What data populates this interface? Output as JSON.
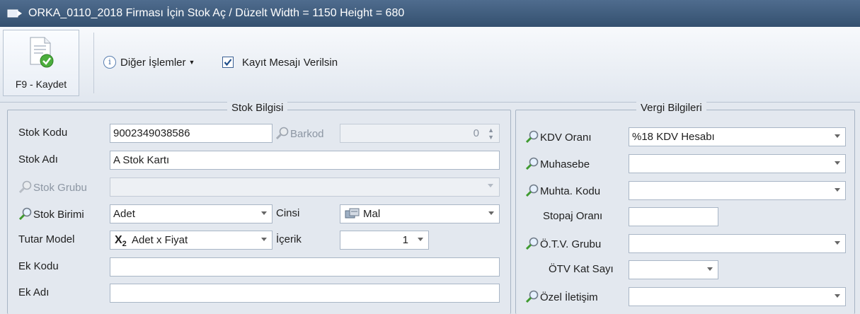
{
  "window": {
    "title": "ORKA_0110_2018 Firması İçin Stok Aç / Düzelt Width = 1150  Height = 680"
  },
  "toolbar": {
    "save_label": "F9 - Kaydet",
    "other_ops_label": "Diğer İşlemler",
    "record_message_label": "Kayıt Mesajı Verilsin",
    "record_message_checked": true
  },
  "stock_group": {
    "title": "Stok Bilgisi",
    "stock_code_label": "Stok Kodu",
    "stock_code_value": "9002349038586",
    "barcode_label": "Barkod",
    "barcode_value": "0",
    "stock_name_label": "Stok Adı",
    "stock_name_value": "A Stok Kartı",
    "stock_group_label": "Stok Grubu",
    "stock_group_value": "",
    "stock_unit_label": "Stok Birimi",
    "stock_unit_value": "Adet",
    "kind_label": "Cinsi",
    "kind_value": "Mal",
    "amount_model_label": "Tutar Model",
    "amount_model_value": "Adet x Fiyat",
    "content_label": "İçerik",
    "content_value": "1",
    "extra_code_label": "Ek Kodu",
    "extra_code_value": "",
    "extra_name_label": "Ek Adı",
    "extra_name_value": ""
  },
  "tax_group": {
    "title": "Vergi Bilgileri",
    "kdv_label": "KDV Oranı",
    "kdv_value": "%18 KDV Hesabı",
    "accounting_label": "Muhasebe",
    "accounting_value": "",
    "acc_code_label": "Muhta. Kodu",
    "acc_code_value": "",
    "stopaj_label": "Stopaj Oranı",
    "stopaj_value": "",
    "otv_group_label": "Ö.T.V. Grubu",
    "otv_group_value": "",
    "otv_factor_label": "ÖTV Kat Sayı",
    "otv_factor_value": "",
    "special_comm_label": "Özel İletişim",
    "special_comm_value": ""
  }
}
